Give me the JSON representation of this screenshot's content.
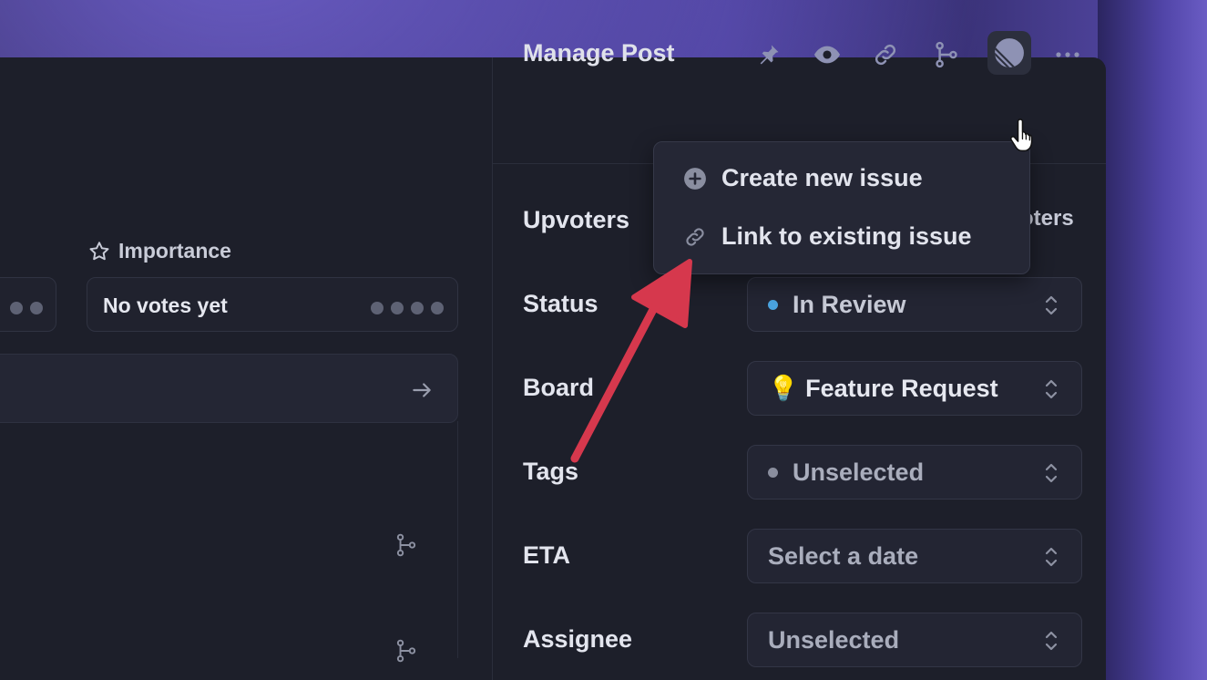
{
  "left": {
    "importance_label": "Importance",
    "votes_text": "No votes yet"
  },
  "header": {
    "title": "Manage Post"
  },
  "menu": {
    "items": [
      {
        "label": "Create new issue",
        "icon": "plus-circle-icon"
      },
      {
        "label": "Link to existing issue",
        "icon": "link-icon"
      }
    ]
  },
  "rows": {
    "upvoters": {
      "label": "Upvoters",
      "value_partial": "oters"
    },
    "status": {
      "label": "Status",
      "value": "In Review",
      "dot_color": "#4aa3df"
    },
    "board": {
      "label": "Board",
      "value": "💡 Feature Request"
    },
    "tags": {
      "label": "Tags",
      "value": "Unselected",
      "dot_color": "#8a8e9e"
    },
    "eta": {
      "label": "ETA",
      "value": "Select a date"
    },
    "assignee": {
      "label": "Assignee",
      "value": "Unselected"
    }
  },
  "colors": {
    "annotation_arrow": "#d6384d",
    "panel_bg": "#1d1f2a",
    "field_bg": "#232533"
  }
}
